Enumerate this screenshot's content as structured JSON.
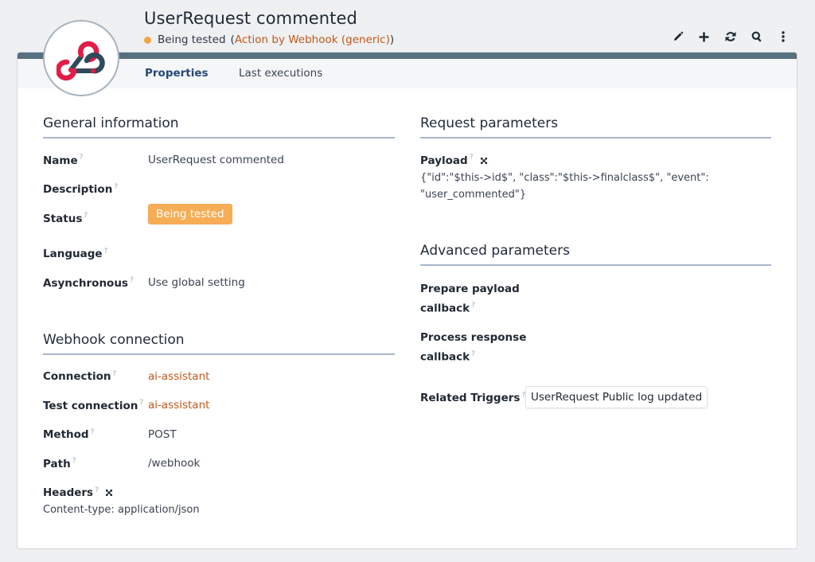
{
  "header": {
    "title": "UserRequest commented",
    "status": "Being tested",
    "class_open": "(",
    "class_link": "Action by Webhook (generic)",
    "class_close": ")",
    "status_color": "#f5a442",
    "toolbar_icons": [
      "pencil-icon",
      "plus-icon",
      "refresh-icon",
      "search-icon",
      "more-icon"
    ]
  },
  "tabs": [
    {
      "label": "Properties",
      "active": true
    },
    {
      "label": "Last executions",
      "active": false
    }
  ],
  "general": {
    "title": "General information",
    "name_label": "Name",
    "name_value": "UserRequest commented",
    "description_label": "Description",
    "status_label": "Status",
    "status_value": "Being tested",
    "language_label": "Language",
    "async_label": "Asynchronous",
    "async_value": "Use global setting"
  },
  "webhook": {
    "title": "Webhook connection",
    "connection_label": "Connection",
    "connection_value": "ai-assistant",
    "test_label": "Test connection",
    "test_value": "ai-assistant",
    "method_label": "Method",
    "method_value": "POST",
    "path_label": "Path",
    "path_value": "/webhook",
    "headers_label": "Headers",
    "headers_value": "Content-type: application/json"
  },
  "request": {
    "title": "Request parameters",
    "payload_label": "Payload",
    "payload_line1": "{\"id\":\"$this->id$\", \"class\":\"$this->finalclass$\", \"event\":",
    "payload_line2": "\"user_commented\"}"
  },
  "advanced": {
    "title": "Advanced parameters",
    "prepare_line1": "Prepare payload",
    "prepare_line2": "callback",
    "process_line1": "Process response",
    "process_line2": "callback",
    "triggers_label": "Related Triggers",
    "triggers_value": "UserRequest Public log updated"
  },
  "help_mark": "?",
  "colors": {
    "accent": "#c1581b",
    "badge": "#f6ad55",
    "header_bar": "#57707f",
    "section_rule": "#a9b6cc"
  }
}
